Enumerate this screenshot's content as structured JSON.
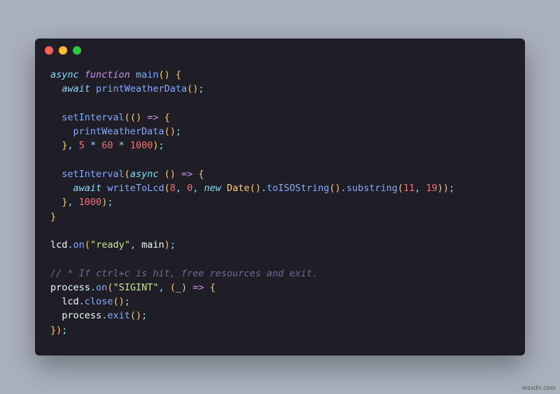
{
  "colors": {
    "page_bg": "#a9b1bd",
    "window_bg": "#1f1e27",
    "dot_red": "#ff5f56",
    "dot_yellow": "#ffbd2e",
    "dot_green": "#27c93f",
    "keyword": "#89ddff",
    "declaration": "#c792ea",
    "function": "#82aaff",
    "punctuation": "#ffcb6b",
    "number": "#f07178",
    "string": "#c3e88d",
    "identifier": "#eeffff",
    "type": "#ffcb6b",
    "comment": "#676e95"
  },
  "watermark": "wsxdn.com",
  "code": {
    "tokens": [
      [
        {
          "t": "async ",
          "c": "c-kw"
        },
        {
          "t": "function ",
          "c": "c-dec"
        },
        {
          "t": "main",
          "c": "c-fn"
        },
        {
          "t": "(",
          "c": "c-punc"
        },
        {
          "t": ") ",
          "c": "c-punc"
        },
        {
          "t": "{",
          "c": "c-punc"
        }
      ],
      [
        {
          "t": "  "
        },
        {
          "t": "await ",
          "c": "c-kw"
        },
        {
          "t": "printWeatherData",
          "c": "c-fn"
        },
        {
          "t": "(",
          "c": "c-punc"
        },
        {
          "t": ")",
          "c": "c-punc"
        },
        {
          "t": ";",
          "c": "c-sc"
        }
      ],
      [],
      [
        {
          "t": "  "
        },
        {
          "t": "setInterval",
          "c": "c-fn"
        },
        {
          "t": "(",
          "c": "c-punc"
        },
        {
          "t": "(",
          "c": "c-punc"
        },
        {
          "t": ") ",
          "c": "c-punc"
        },
        {
          "t": "=> ",
          "c": "c-dec"
        },
        {
          "t": "{",
          "c": "c-punc"
        }
      ],
      [
        {
          "t": "    "
        },
        {
          "t": "printWeatherData",
          "c": "c-fn"
        },
        {
          "t": "(",
          "c": "c-punc"
        },
        {
          "t": ")",
          "c": "c-punc"
        },
        {
          "t": ";",
          "c": "c-sc"
        }
      ],
      [
        {
          "t": "  "
        },
        {
          "t": "}",
          "c": "c-punc"
        },
        {
          "t": ", ",
          "c": "c-sc"
        },
        {
          "t": "5",
          "c": "c-num"
        },
        {
          "t": " * ",
          "c": "c-op"
        },
        {
          "t": "60",
          "c": "c-num"
        },
        {
          "t": " * ",
          "c": "c-op"
        },
        {
          "t": "1000",
          "c": "c-num"
        },
        {
          "t": ")",
          "c": "c-punc"
        },
        {
          "t": ";",
          "c": "c-sc"
        }
      ],
      [],
      [
        {
          "t": "  "
        },
        {
          "t": "setInterval",
          "c": "c-fn"
        },
        {
          "t": "(",
          "c": "c-punc"
        },
        {
          "t": "async ",
          "c": "c-kw"
        },
        {
          "t": "(",
          "c": "c-punc"
        },
        {
          "t": ") ",
          "c": "c-punc"
        },
        {
          "t": "=> ",
          "c": "c-dec"
        },
        {
          "t": "{",
          "c": "c-punc"
        }
      ],
      [
        {
          "t": "    "
        },
        {
          "t": "await ",
          "c": "c-kw"
        },
        {
          "t": "writeToLcd",
          "c": "c-fn"
        },
        {
          "t": "(",
          "c": "c-punc"
        },
        {
          "t": "8",
          "c": "c-num"
        },
        {
          "t": ", ",
          "c": "c-sc"
        },
        {
          "t": "0",
          "c": "c-num"
        },
        {
          "t": ", ",
          "c": "c-sc"
        },
        {
          "t": "new ",
          "c": "c-kw"
        },
        {
          "t": "Date",
          "c": "c-type"
        },
        {
          "t": "(",
          "c": "c-punc"
        },
        {
          "t": ")",
          "c": "c-punc"
        },
        {
          "t": ".",
          "c": "c-sc"
        },
        {
          "t": "toISOString",
          "c": "c-fn"
        },
        {
          "t": "(",
          "c": "c-punc"
        },
        {
          "t": ")",
          "c": "c-punc"
        },
        {
          "t": ".",
          "c": "c-sc"
        },
        {
          "t": "substring",
          "c": "c-fn"
        },
        {
          "t": "(",
          "c": "c-punc"
        },
        {
          "t": "11",
          "c": "c-num"
        },
        {
          "t": ", ",
          "c": "c-sc"
        },
        {
          "t": "19",
          "c": "c-num"
        },
        {
          "t": ")",
          "c": "c-punc"
        },
        {
          "t": ")",
          "c": "c-punc"
        },
        {
          "t": ";",
          "c": "c-sc"
        }
      ],
      [
        {
          "t": "  "
        },
        {
          "t": "}",
          "c": "c-punc"
        },
        {
          "t": ", ",
          "c": "c-sc"
        },
        {
          "t": "1000",
          "c": "c-num"
        },
        {
          "t": ")",
          "c": "c-punc"
        },
        {
          "t": ";",
          "c": "c-sc"
        }
      ],
      [
        {
          "t": "}",
          "c": "c-punc"
        }
      ],
      [],
      [
        {
          "t": "lcd",
          "c": "c-var"
        },
        {
          "t": ".",
          "c": "c-sc"
        },
        {
          "t": "on",
          "c": "c-fn"
        },
        {
          "t": "(",
          "c": "c-punc"
        },
        {
          "t": "\"ready\"",
          "c": "c-str"
        },
        {
          "t": ", ",
          "c": "c-sc"
        },
        {
          "t": "main",
          "c": "c-var"
        },
        {
          "t": ")",
          "c": "c-punc"
        },
        {
          "t": ";",
          "c": "c-sc"
        }
      ],
      [],
      [
        {
          "t": "// * If ctrl+c is hit, free resources and exit.",
          "c": "c-cm"
        }
      ],
      [
        {
          "t": "process",
          "c": "c-var"
        },
        {
          "t": ".",
          "c": "c-sc"
        },
        {
          "t": "on",
          "c": "c-fn"
        },
        {
          "t": "(",
          "c": "c-punc"
        },
        {
          "t": "\"SIGINT\"",
          "c": "c-str"
        },
        {
          "t": ", ",
          "c": "c-sc"
        },
        {
          "t": "(",
          "c": "c-punc"
        },
        {
          "t": "_",
          "c": "c-var"
        },
        {
          "t": ") ",
          "c": "c-punc"
        },
        {
          "t": "=> ",
          "c": "c-dec"
        },
        {
          "t": "{",
          "c": "c-punc"
        }
      ],
      [
        {
          "t": "  "
        },
        {
          "t": "lcd",
          "c": "c-var"
        },
        {
          "t": ".",
          "c": "c-sc"
        },
        {
          "t": "close",
          "c": "c-fn"
        },
        {
          "t": "(",
          "c": "c-punc"
        },
        {
          "t": ")",
          "c": "c-punc"
        },
        {
          "t": ";",
          "c": "c-sc"
        }
      ],
      [
        {
          "t": "  "
        },
        {
          "t": "process",
          "c": "c-var"
        },
        {
          "t": ".",
          "c": "c-sc"
        },
        {
          "t": "exit",
          "c": "c-fn"
        },
        {
          "t": "(",
          "c": "c-punc"
        },
        {
          "t": ")",
          "c": "c-punc"
        },
        {
          "t": ";",
          "c": "c-sc"
        }
      ],
      [
        {
          "t": "}",
          "c": "c-punc"
        },
        {
          "t": ")",
          "c": "c-punc"
        },
        {
          "t": ";",
          "c": "c-sc"
        }
      ]
    ]
  }
}
